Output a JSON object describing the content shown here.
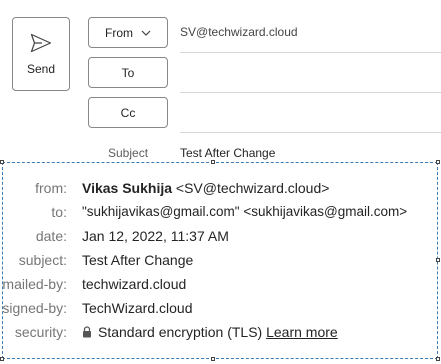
{
  "compose": {
    "send_label": "Send",
    "from_button": "From",
    "to_button": "To",
    "cc_button": "Cc",
    "from_value": "SV@techwizard.cloud",
    "subject_label": "Subject",
    "subject_value": "Test After Change"
  },
  "details": {
    "from": {
      "label": "from:",
      "name": "Vikas Sukhija",
      "address": "<SV@techwizard.cloud>"
    },
    "to": {
      "label": "to:",
      "value": "\"sukhijavikas@gmail.com\" <sukhijavikas@gmail.com>"
    },
    "date": {
      "label": "date:",
      "value": "Jan 12, 2022, 11:37 AM"
    },
    "subject": {
      "label": "subject:",
      "value": "Test After Change"
    },
    "mailed_by": {
      "label": "mailed-by:",
      "value": "techwizard.cloud"
    },
    "signed_by": {
      "label": "signed-by:",
      "value": "TechWizard.cloud"
    },
    "security": {
      "label": "security:",
      "icon": "lock-icon",
      "value": "Standard encryption (TLS)",
      "link": "Learn more"
    }
  }
}
